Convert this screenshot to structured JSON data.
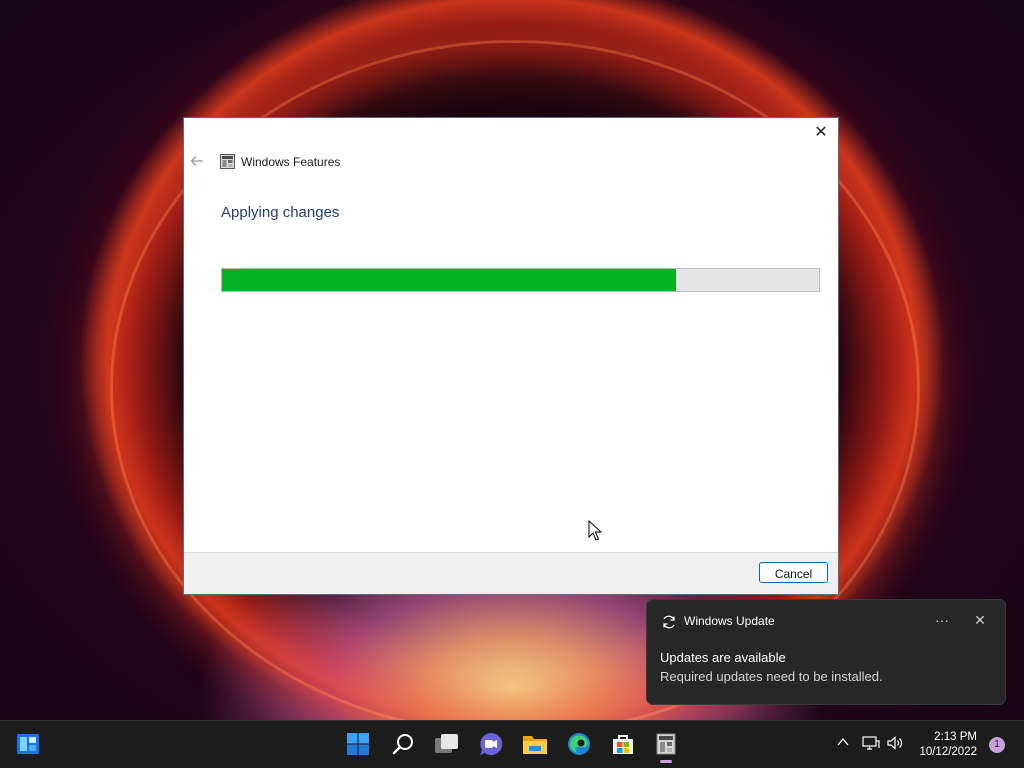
{
  "dialog": {
    "title": "Windows Features",
    "heading": "Applying changes",
    "progress_percent": 76,
    "cancel_label": "Cancel",
    "icons": {
      "back": "back-arrow-icon",
      "app": "windows-features-icon",
      "close": "close-icon"
    }
  },
  "toast": {
    "app_name": "Windows Update",
    "title": "Updates are available",
    "body": "Required updates need to be installed.",
    "more_glyph": "···",
    "close_glyph": "✕"
  },
  "taskbar": {
    "icons": [
      "widgets-icon",
      "start-icon",
      "search-icon",
      "task-view-icon",
      "chat-icon",
      "file-explorer-icon",
      "edge-icon",
      "store-icon",
      "windows-features-icon"
    ],
    "tray": {
      "chevron_glyph": "^",
      "time": "2:13 PM",
      "date": "10/12/2022",
      "notification_count": "1"
    }
  },
  "colors": {
    "progress_fill": "#06b025",
    "heading": "#1f3d7a",
    "accent": "#0067c0",
    "toast_bg": "#272727",
    "taskbar_bg": "#1c1c1c"
  }
}
